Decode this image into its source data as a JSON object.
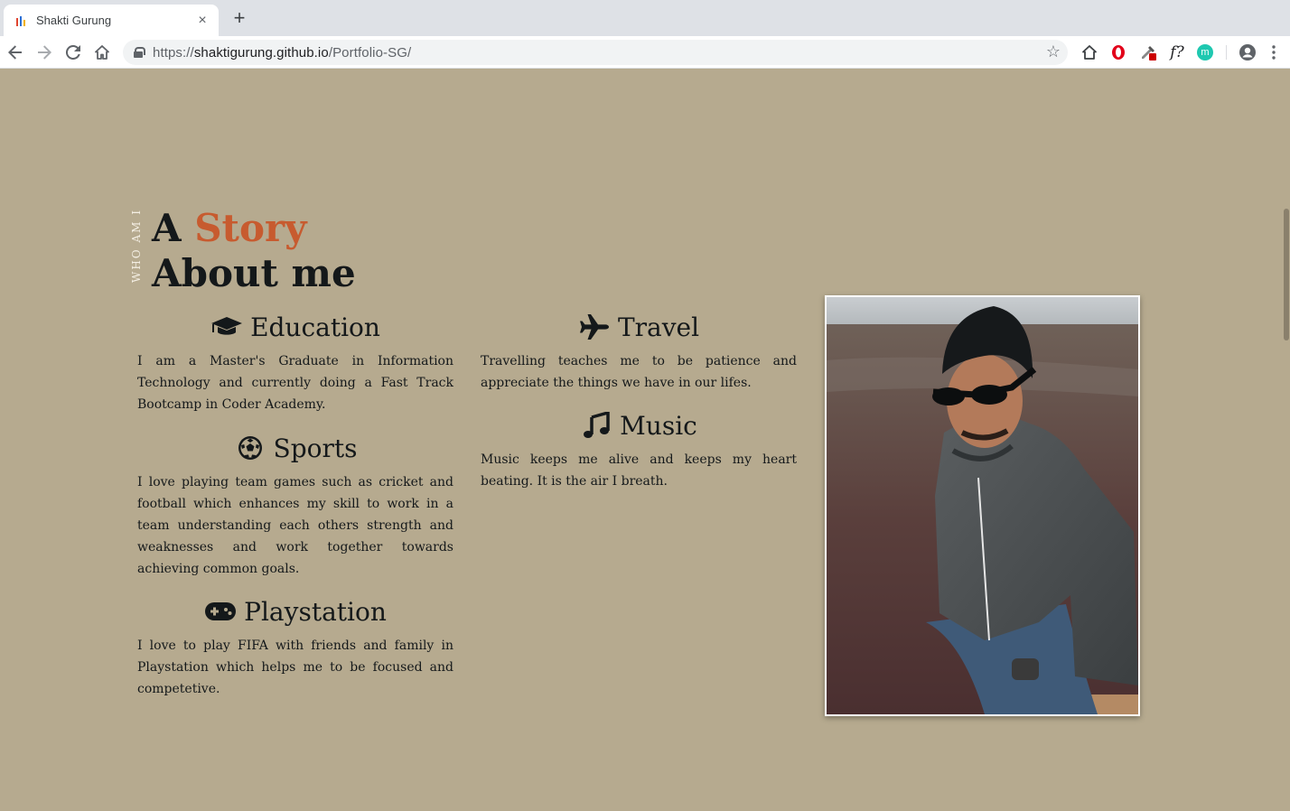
{
  "browser": {
    "tab": {
      "title": "Shakti Gurung",
      "close": "×"
    },
    "new_tab": "+",
    "url": {
      "scheme": "https://",
      "host": "shaktigurung.github.io",
      "path": "/Portfolio-SG/"
    },
    "extensions": [
      "home-icon",
      "opera-icon",
      "eyedropper-icon",
      "font-identifier-icon",
      "m-extension-icon",
      "account-icon",
      "menu-icon"
    ],
    "font_ext_label": "f?",
    "m_ext_label": "m"
  },
  "about": {
    "vertical_label": "WHO AM I",
    "heading_prefix": "A ",
    "heading_accent": "Story",
    "heading_line2": "About me",
    "accent_color": "#c75b2f",
    "background_color": "#b6aa8f",
    "cards": [
      {
        "icon": "graduation-cap-icon",
        "title": "Education",
        "text": "I am a Master's Graduate in Information Technology and currently doing a Fast Track Bootcamp in Coder Academy."
      },
      {
        "icon": "soccer-ball-icon",
        "title": "Sports",
        "text": "I love playing team games such as cricket and football which enhances my skill to work in a team understanding each others strength and weaknesses and work together towards achieving common goals."
      },
      {
        "icon": "gamepad-icon",
        "title": "Playstation",
        "text": "I love to play FIFA with friends and family in Playstation which helps me to be focused and competetive."
      },
      {
        "icon": "plane-icon",
        "title": "Travel",
        "text": "Travelling teaches me to be patience and appreciate the things we have in our lifes."
      },
      {
        "icon": "music-note-icon",
        "title": "Music",
        "text": "Music keeps me alive and keeps my heart beating. It is the air I breath."
      }
    ]
  }
}
